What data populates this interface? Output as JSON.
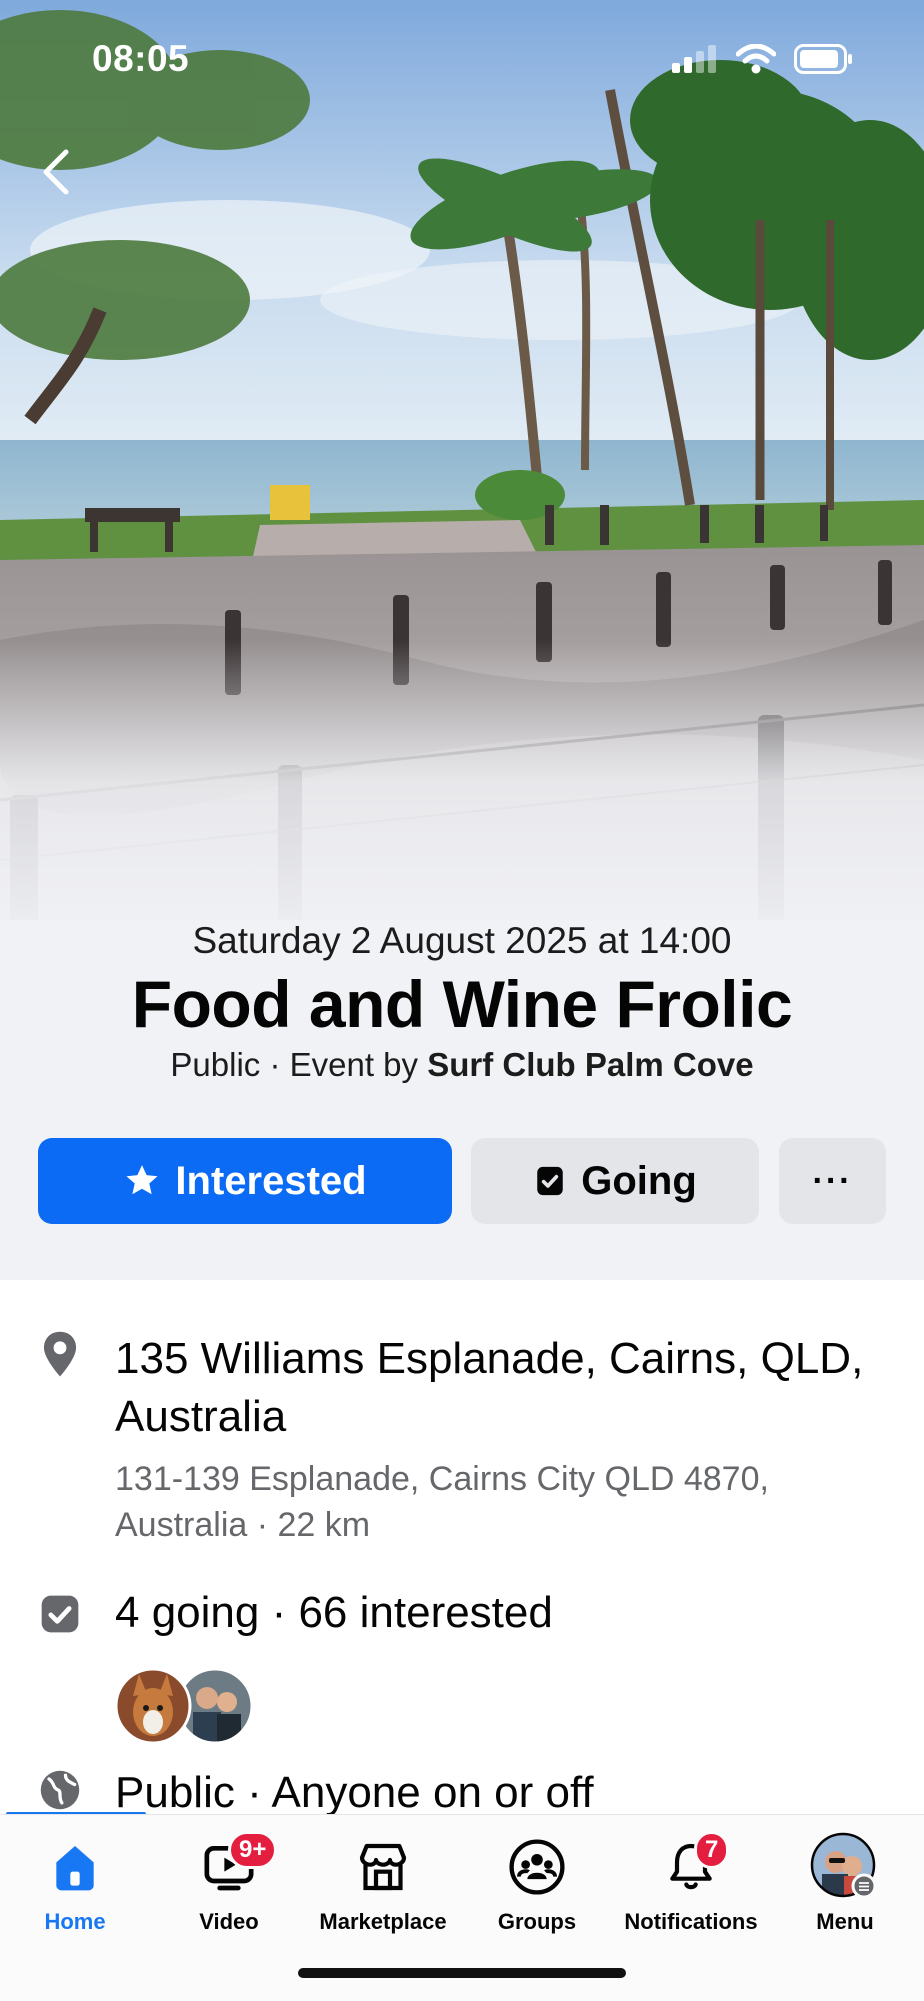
{
  "status_bar": {
    "time": "08:05"
  },
  "event": {
    "datetime": "Saturday 2 August 2025 at 14:00",
    "title": "Food and Wine Frolic",
    "visibility": "Public",
    "byline_prefix": "· Event by",
    "host": "Surf Club Palm Cove"
  },
  "actions": {
    "interested_label": "Interested",
    "going_label": "Going",
    "more_label": "···"
  },
  "details": {
    "location_title": "135 Williams Esplanade, Cairns, QLD, Australia",
    "location_subtitle": "131-139 Esplanade, Cairns City QLD 4870, Australia · 22 km",
    "attendance": "4 going · 66 interested",
    "privacy": "Public · Anyone on or off"
  },
  "tabs": [
    {
      "label": "Home",
      "icon": "home-icon",
      "active": true
    },
    {
      "label": "Video",
      "icon": "video-icon",
      "badge": "9+"
    },
    {
      "label": "Marketplace",
      "icon": "marketplace-icon"
    },
    {
      "label": "Groups",
      "icon": "groups-icon"
    },
    {
      "label": "Notifications",
      "icon": "bell-icon",
      "badge": "7"
    },
    {
      "label": "Menu",
      "icon": "avatar"
    }
  ],
  "colors": {
    "accent": "#0b6bf5",
    "badge": "#e41e3f",
    "button_secondary": "#e4e5e9"
  }
}
